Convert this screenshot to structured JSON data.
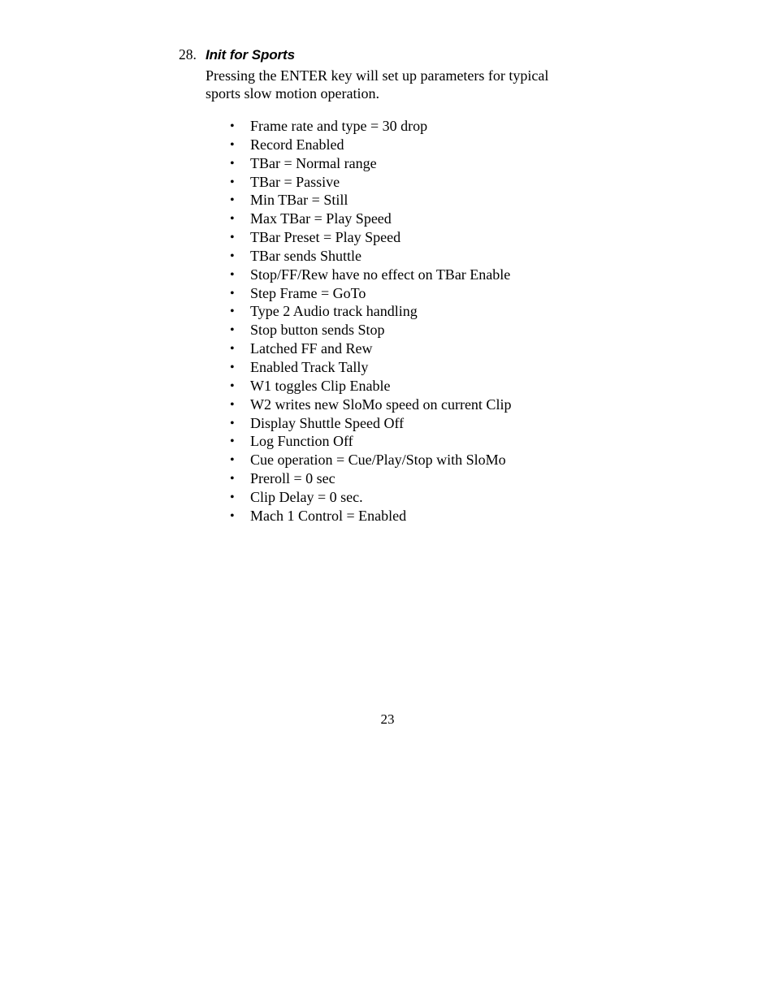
{
  "document": {
    "item_number": "28.",
    "item_title": "Init for Sports",
    "paragraph_line_1": "Pressing the ENTER key will set up parameters for typical",
    "paragraph_line_2": "sports slow motion operation.",
    "bullet_marker": "•",
    "bullets": [
      "Frame rate and type = 30 drop",
      "Record Enabled",
      "TBar = Normal range",
      "TBar = Passive",
      "Min TBar = Still",
      "Max TBar = Play Speed",
      "TBar Preset = Play Speed",
      "TBar sends Shuttle",
      "Stop/FF/Rew have no effect on TBar Enable",
      "Step Frame = GoTo",
      "Type 2 Audio track handling",
      "Stop button sends Stop",
      "Latched FF and Rew",
      "Enabled Track Tally",
      "W1 toggles Clip Enable",
      "W2 writes new SloMo speed on current Clip",
      "Display Shuttle Speed Off",
      "Log Function Off",
      "Cue operation = Cue/Play/Stop with SloMo",
      "Preroll = 0 sec",
      "Clip Delay = 0 sec.",
      "Mach 1 Control = Enabled"
    ],
    "page_number": "23"
  }
}
